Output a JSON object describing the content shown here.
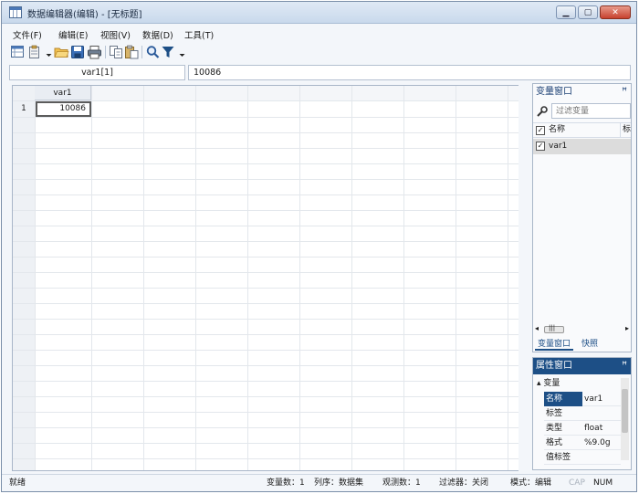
{
  "window": {
    "title": "数据编辑器(编辑) - [无标题]"
  },
  "menu": [
    "文件(F)",
    "编辑(E)",
    "视图(V)",
    "数据(D)",
    "工具(T)"
  ],
  "toolbar_icons": [
    "data-editor-icon",
    "paste-special-icon",
    "open-folder-icon",
    "save-icon",
    "print-icon",
    "copy-icon",
    "paste-icon",
    "find-icon",
    "filter-icon"
  ],
  "cell_ref": "var1[1]",
  "cell_value": "10086",
  "grid": {
    "columns": [
      "var1"
    ],
    "rows": [
      {
        "row": "1",
        "var1": "10086"
      }
    ]
  },
  "variables_panel": {
    "title": "变量窗口",
    "pin": "ꟸ",
    "filter_placeholder": "过滤变量",
    "col_name": "名称",
    "col_label": "标",
    "variables": [
      {
        "name": "var1",
        "checked": true
      }
    ],
    "tabs": [
      "变量窗口",
      "快照"
    ],
    "scroll_left": "◂",
    "scroll_right": "▸",
    "scroll_thumb": "|||"
  },
  "properties_panel": {
    "title": "属性窗口",
    "group": "▴ 变量",
    "rows": [
      {
        "key": "名称",
        "value": "var1"
      },
      {
        "key": "标签",
        "value": ""
      },
      {
        "key": "类型",
        "value": "float"
      },
      {
        "key": "格式",
        "value": "%9.0g"
      },
      {
        "key": "值标签",
        "value": ""
      }
    ]
  },
  "status": {
    "ready": "就绪",
    "var_count": "变量数：1",
    "order": "列序：数据集",
    "obs": "观测数：1",
    "filter": "过滤器：关闭",
    "mode": "模式：编辑",
    "cap": "CAP",
    "num": "NUM"
  },
  "colors": {
    "accent": "#1d4f86",
    "titlebar": "#c9d9ec",
    "selection": "#dcdcdc"
  }
}
